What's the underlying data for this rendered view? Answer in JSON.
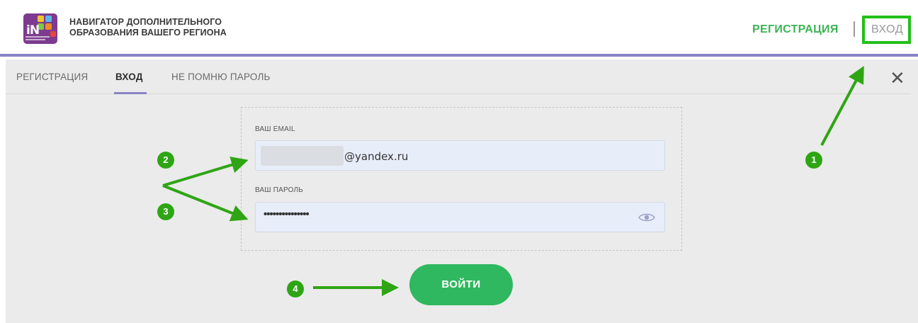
{
  "header": {
    "brand_line1": "НАВИГАТОР ДОПОЛНИТЕЛЬНОГО",
    "brand_line2": "ОБРАЗОВАНИЯ ВАШЕГО РЕГИОНА",
    "logo_text": "iN",
    "register_link": "РЕГИСТРАЦИЯ",
    "login_link": "ВХОД"
  },
  "tabs": [
    {
      "label": "РЕГИСТРАЦИЯ",
      "active": false
    },
    {
      "label": "ВХОД",
      "active": true
    },
    {
      "label": "НЕ ПОМНЮ ПАРОЛЬ",
      "active": false
    }
  ],
  "close_icon": "close-icon",
  "form": {
    "email_label": "ВАШ EMAIL",
    "email_value": "@yandex.ru",
    "password_label": "ВАШ ПАРОЛЬ",
    "password_value": "•••••••••••••••",
    "submit_label": "ВОЙТИ",
    "eye_icon": "eye-icon"
  },
  "annotations": {
    "badge_1": "1",
    "badge_2": "2",
    "badge_3": "3",
    "badge_4": "4"
  },
  "colors": {
    "accent_purple": "#8a84c6",
    "brand_green": "#3cb454",
    "button_green": "#2fb85f",
    "highlight_green": "#22c01a",
    "annotation_green": "#2fa515",
    "logo_purple": "#7d3b8f"
  }
}
